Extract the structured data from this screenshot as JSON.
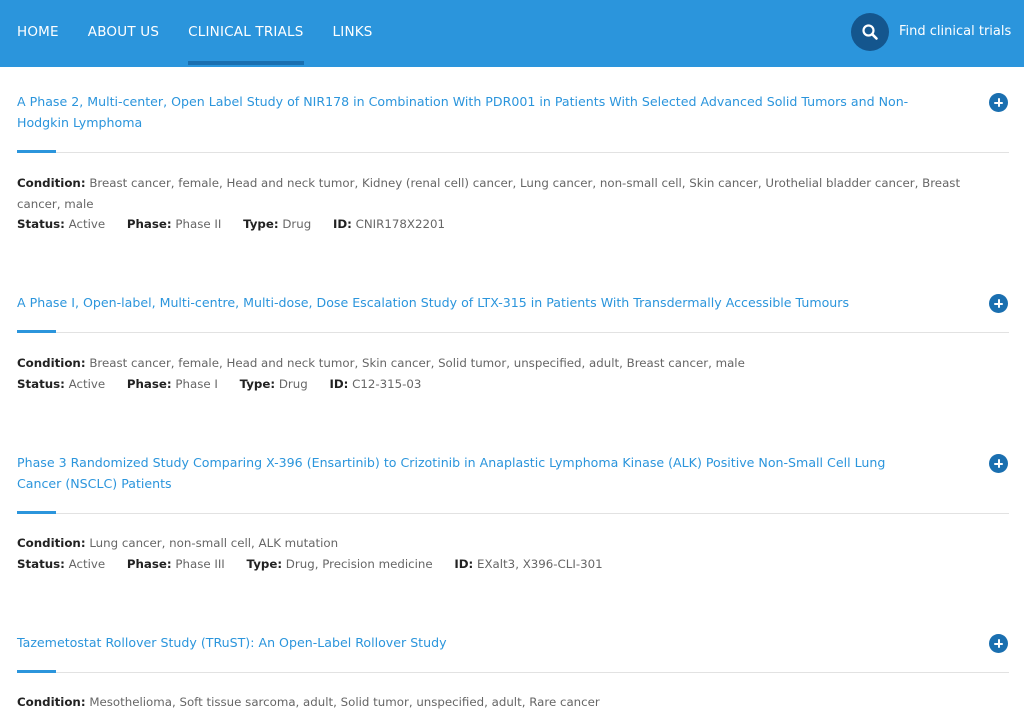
{
  "nav": {
    "items": [
      {
        "label": "HOME"
      },
      {
        "label": "ABOUT US"
      },
      {
        "label": "CLINICAL TRIALS"
      },
      {
        "label": "LINKS"
      }
    ],
    "find_label": "Find clinical trials",
    "accent": "#2b95dc"
  },
  "labels": {
    "condition": "Condition:",
    "status": "Status:",
    "phase": "Phase:",
    "type": "Type:",
    "id": "ID:"
  },
  "trials": [
    {
      "title": "A Phase 2, Multi-center, Open Label Study of NIR178 in Combination With PDR001 in Patients With Selected Advanced Solid Tumors and Non-Hodgkin Lymphoma",
      "condition": "Breast cancer, female, Head and neck tumor, Kidney (renal cell) cancer, Lung cancer, non-small cell, Skin cancer, Urothelial bladder cancer, Breast cancer, male",
      "status": "Active",
      "phase": "Phase II",
      "type": "Drug",
      "id": "CNIR178X2201"
    },
    {
      "title": "A Phase I, Open-label, Multi-centre, Multi-dose, Dose Escalation Study of LTX-315 in Patients With Transdermally Accessible Tumours",
      "condition": "Breast cancer, female, Head and neck tumor, Skin cancer, Solid tumor, unspecified, adult, Breast cancer, male",
      "status": "Active",
      "phase": "Phase I",
      "type": "Drug",
      "id": "C12-315-03"
    },
    {
      "title": "Phase 3 Randomized Study Comparing X-396 (Ensartinib) to Crizotinib in Anaplastic Lymphoma Kinase (ALK) Positive Non-Small Cell Lung Cancer (NSCLC) Patients",
      "condition": "Lung cancer, non-small cell, ALK mutation",
      "status": "Active",
      "phase": "Phase III",
      "type": "Drug, Precision medicine",
      "id": "EXalt3, X396-CLI-301"
    },
    {
      "title": "Tazemetostat Rollover Study (TRuST): An Open-Label Rollover Study",
      "condition": "Mesothelioma, Soft tissue sarcoma, adult, Solid tumor, unspecified, adult, Rare cancer"
    }
  ]
}
